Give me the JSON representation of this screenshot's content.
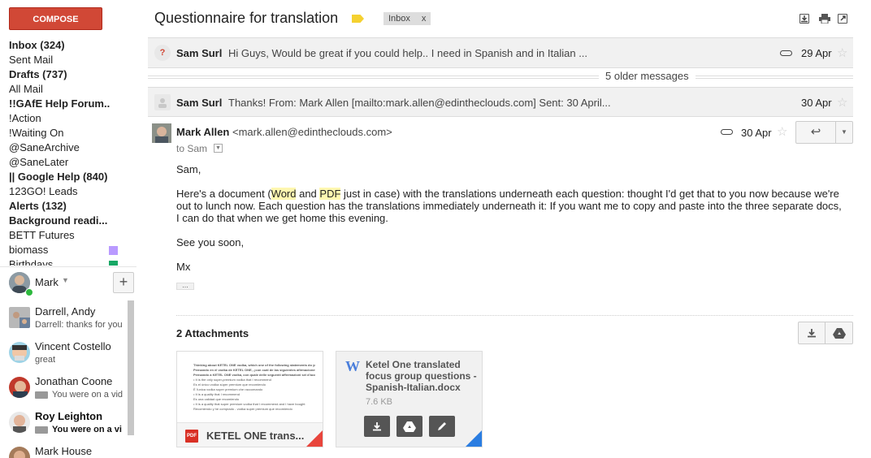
{
  "sidebar": {
    "compose_label": "COMPOSE",
    "labels": [
      {
        "text": "Inbox (324)",
        "bold": true
      },
      {
        "text": "Sent Mail",
        "bold": false
      },
      {
        "text": "Drafts (737)",
        "bold": true
      },
      {
        "text": "All Mail",
        "bold": false
      },
      {
        "text": "!!GAfE Help Forum..",
        "bold": true
      },
      {
        "text": "!Action",
        "bold": false
      },
      {
        "text": "!Waiting On",
        "bold": false
      },
      {
        "text": "@SaneArchive",
        "bold": false
      },
      {
        "text": "@SaneLater",
        "bold": false
      },
      {
        "text": "|| Google Help (840)",
        "bold": true
      },
      {
        "text": "123GO! Leads",
        "bold": false
      },
      {
        "text": "Alerts (132)",
        "bold": true
      },
      {
        "text": "Background readi...",
        "bold": true
      },
      {
        "text": "BETT Futures",
        "bold": false
      },
      {
        "text": "biomass",
        "bold": false,
        "color": "#b99aff"
      },
      {
        "text": "Birthdays",
        "bold": false,
        "color": "#16a765"
      }
    ]
  },
  "chat": {
    "me_name": "Mark",
    "contacts": [
      {
        "name": "Darrell, Andy",
        "status": "Darrell: thanks for you",
        "bold": false,
        "video": false
      },
      {
        "name": "Vincent Costello",
        "status": "great",
        "bold": false,
        "video": false
      },
      {
        "name": "Jonathan Coone",
        "status": "You were on a vid",
        "bold": false,
        "video": true
      },
      {
        "name": "Roy Leighton",
        "status": "You were on a vi",
        "bold": true,
        "video": true
      },
      {
        "name": "Mark House",
        "status": "",
        "bold": false,
        "video": false
      }
    ]
  },
  "thread": {
    "subject": "Questionnaire for translation",
    "inbox_chip": "Inbox",
    "inbox_chip_close": "x",
    "tag_color": "#f5d130",
    "messages_collapsed": [
      {
        "avatar": "?",
        "from": "Sam Surl",
        "snippet": "Hi Guys, Would be great if you could help.. I need in Spanish and in Italian ...",
        "date": "29 Apr",
        "has_attachment": true
      },
      {
        "avatar": "",
        "from": "Sam Surl",
        "snippet": "Thanks! From: Mark Allen [mailto:mark.allen@edintheclouds.com] Sent: 30 April...",
        "date": "30 Apr",
        "has_attachment": false
      }
    ],
    "older_messages": "5 older messages"
  },
  "message": {
    "from_name": "Mark Allen",
    "from_email": "<mark.allen@edintheclouds.com>",
    "to": "to Sam",
    "date": "30 Apr",
    "greeting": "Sam,",
    "body_parts": {
      "p1": "Here's a document (",
      "word": "Word",
      "and": " and ",
      "pdf": "PDF",
      "p2": " just in case) with the translations underneath each question: thought I'd get that to you now because we're out to lunch now.  Each question has the translations immediately underneath it: If you want me to copy and paste into the three separate docs, I can do that when we get home this evening."
    },
    "closing": "See you soon,",
    "signature": "Mx",
    "ellipsis": "..."
  },
  "attachments": {
    "title": "2 Attachments",
    "items": [
      {
        "name": "KETEL ONE trans...",
        "type_badge": "PDF",
        "corner_color": "#e8453c"
      },
      {
        "name": "Ketel One translated focus group questions - Spanish-Italian.docx",
        "size": "7.6 KB",
        "type_badge": "W",
        "corner_color": "#2a7de1"
      }
    ],
    "preview_lines": [
      "Thinking about KETEL ONE vodka, which one of the following statements do you agree with most?",
      "Pensando en el vodka de KETEL ONE, ¿con cuál de las siguientes afirmaciones está más de acuerdo?",
      "Pensando a KETEL ONE vodka, con quale delle seguenti affermazioni sei d'accordo?",
      "• It is the only super-premium vodka that I recommend",
      "  Es el único vodka súper premium que recomiendo",
      "  È l'unica vodka super premium che raccomando",
      "• It is a quality that I recommend",
      "  Es una calidad que recomiendo",
      "• It is a quality that super premium vodka that I recommend and I have bought",
      "  Recomiendo y he comprado - vodka super premium que recomiendo"
    ]
  }
}
